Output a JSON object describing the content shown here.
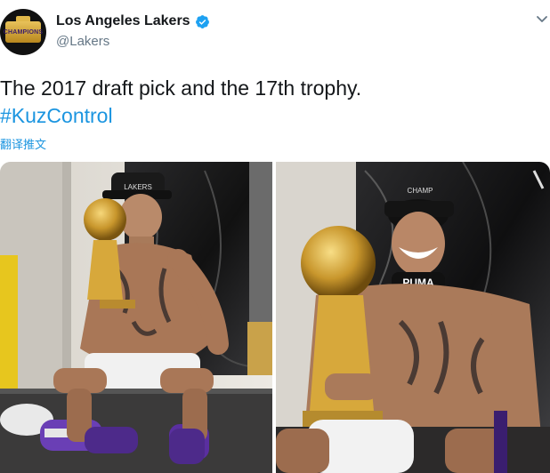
{
  "account": {
    "display_name": "Los Angeles Lakers",
    "handle": "@Lakers",
    "avatar_badge": "CHAMPIONS",
    "verified": true
  },
  "tweet": {
    "line1": "The 2017 draft pick and the 17th trophy.",
    "hashtag": "#KuzControl",
    "translate_label": "翻译推文"
  },
  "photos": {
    "left_alt": "Player seated with championship trophy in locker room",
    "right_alt": "Player smiling while holding championship trophy"
  },
  "colors": {
    "link": "#1b95e0",
    "verified": "#1da1f2",
    "handle": "#657786"
  },
  "icons": {
    "verified": "verified-badge-icon",
    "caret": "chevron-down-icon"
  }
}
